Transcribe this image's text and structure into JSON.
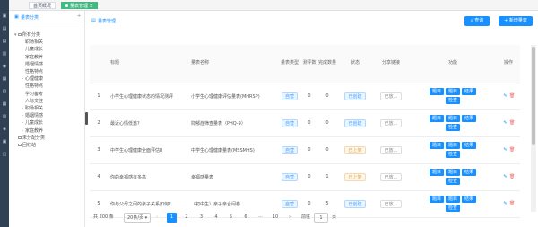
{
  "tabs": [
    {
      "label": "首页概况",
      "active": false
    },
    {
      "label": "量表管理",
      "active": true
    }
  ],
  "tree": {
    "title": "量表分类",
    "nodes": [
      {
        "label": "所有分类",
        "level": 0,
        "arrow": "▾",
        "folder": true
      },
      {
        "label": "职场相关",
        "level": 1,
        "arrow": "",
        "folder": false
      },
      {
        "label": "儿童成长",
        "level": 1,
        "arrow": "",
        "folder": false
      },
      {
        "label": "家庭教养",
        "level": 1,
        "arrow": "",
        "folder": false
      },
      {
        "label": "婚姻情感",
        "level": 1,
        "arrow": "",
        "folder": false
      },
      {
        "label": "性格特点",
        "level": 1,
        "arrow": "",
        "folder": false
      },
      {
        "label": "心理健康",
        "level": 1,
        "arrow": "›",
        "folder": false
      },
      {
        "label": "性格特点",
        "level": 1,
        "arrow": "",
        "folder": false
      },
      {
        "label": "学习备考",
        "level": 1,
        "arrow": "",
        "folder": false
      },
      {
        "label": "人际交往",
        "level": 1,
        "arrow": "",
        "folder": false
      },
      {
        "label": "职场相关",
        "level": 1,
        "arrow": "›",
        "folder": false
      },
      {
        "label": "婚姻情感",
        "level": 1,
        "arrow": "›",
        "folder": false
      },
      {
        "label": "儿童成长",
        "level": 1,
        "arrow": "›",
        "folder": false
      },
      {
        "label": "家庭教养",
        "level": 1,
        "arrow": "›",
        "folder": false
      },
      {
        "label": "未分配分类",
        "level": 0,
        "arrow": "",
        "folder": true
      },
      {
        "label": "回收站",
        "level": 0,
        "arrow": "",
        "folder": true
      }
    ]
  },
  "main": {
    "title": "量表管理",
    "search_label": "查询",
    "add_label": "+ 新增量表",
    "columns": [
      "",
      "标题",
      "量表名称",
      "量表类型",
      "测评数",
      "完成数量",
      "状态",
      "分享链接",
      "功能",
      "操作"
    ],
    "rows": [
      {
        "no": "1",
        "title": "小学生心理健康状态的情况测评",
        "scale": "小学生心理健康评估量表(MHRSP)",
        "type": "自营",
        "c1": "0",
        "c2": "0",
        "status": "已创建",
        "pub": false,
        "share": "已放...",
        "funcs": [
          "题目",
          "题目",
          "结果",
          "检查"
        ]
      },
      {
        "no": "2",
        "title": "最近心情低落?",
        "scale": "抑郁症筛查量表（PHQ-9）",
        "type": "自营",
        "c1": "0",
        "c2": "0",
        "status": "已创建",
        "pub": false,
        "share": "已放...",
        "funcs": [
          "题目",
          "题目",
          "结果",
          "检查"
        ]
      },
      {
        "no": "3",
        "title": "中学生心理健康全面评估II",
        "scale": "中学生心理健康量表(MSSMHS)",
        "type": "自营",
        "c1": "0",
        "c2": "0",
        "status": "已上架",
        "pub": true,
        "share": "已放...",
        "funcs": [
          "题目",
          "题目",
          "结果",
          "检查"
        ]
      },
      {
        "no": "4",
        "title": "你的幸福感有多高",
        "scale": "幸福感量表",
        "type": "自营",
        "c1": "0",
        "c2": "1",
        "status": "已上架",
        "pub": true,
        "share": "已放...",
        "funcs": [
          "题目",
          "题目",
          "结果",
          "检查"
        ]
      },
      {
        "no": "5",
        "title": "你与父母之间的亲子关系如何?",
        "scale": "（初中生）亲子亲合问卷",
        "type": "自营",
        "c1": "0",
        "c2": "5",
        "status": "已创建",
        "pub": false,
        "share": "已放...",
        "funcs": [
          "题目",
          "题目",
          "结果",
          "检查"
        ]
      }
    ]
  },
  "pager": {
    "total": "共 200 条",
    "size": "20条/页",
    "pages": [
      "1",
      "2",
      "3",
      "4",
      "5",
      "6",
      "···",
      "10"
    ],
    "current": "1",
    "goto_label": "前往",
    "goto_value": "1",
    "page_unit": "页"
  },
  "colors": {
    "accent": "#1890ff",
    "rail": "#304156",
    "tab_active": "#42b983"
  }
}
